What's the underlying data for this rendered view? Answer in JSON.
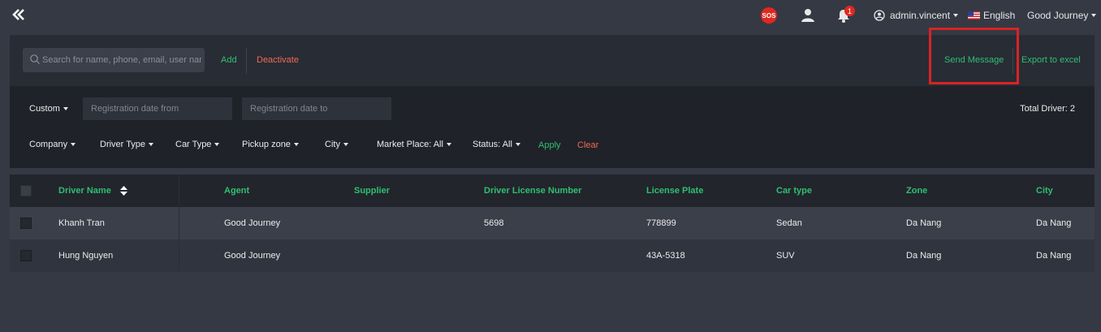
{
  "topbar": {
    "sos_label": "SOS",
    "notification_count": "1",
    "user": "admin.vincent",
    "language": "English",
    "company": "Good Journey"
  },
  "actions": {
    "search_placeholder": "Search for name, phone, email, user name",
    "add_label": "Add",
    "deactivate_label": "Deactivate",
    "send_message_label": "Send Message",
    "export_label": "Export to excel"
  },
  "filters": {
    "custom_label": "Custom",
    "date_from_placeholder": "Registration date from",
    "date_to_placeholder": "Registration date to",
    "total_label": "Total Driver: 2",
    "dropdowns": [
      "Company",
      "Driver Type",
      "Car Type",
      "Pickup zone",
      "City",
      "Market Place: All",
      "Status: All"
    ],
    "apply_label": "Apply",
    "clear_label": "Clear"
  },
  "table": {
    "columns": [
      "Driver Name",
      "Agent",
      "Supplier",
      "Driver License Number",
      "License Plate",
      "Car type",
      "Zone",
      "City"
    ],
    "rows": [
      [
        "Khanh Tran",
        "Good Journey",
        "",
        "5698",
        "778899",
        "Sedan",
        "Da Nang",
        "Da Nang"
      ],
      [
        "Hung Nguyen",
        "Good Journey",
        "",
        "",
        "43A-5318",
        "SUV",
        "Da Nang",
        "Da Nang"
      ]
    ]
  },
  "colors": {
    "accent_green": "#2fbf71",
    "accent_red": "#ef6a52",
    "highlight_red": "#d92323",
    "background": "#353944"
  }
}
